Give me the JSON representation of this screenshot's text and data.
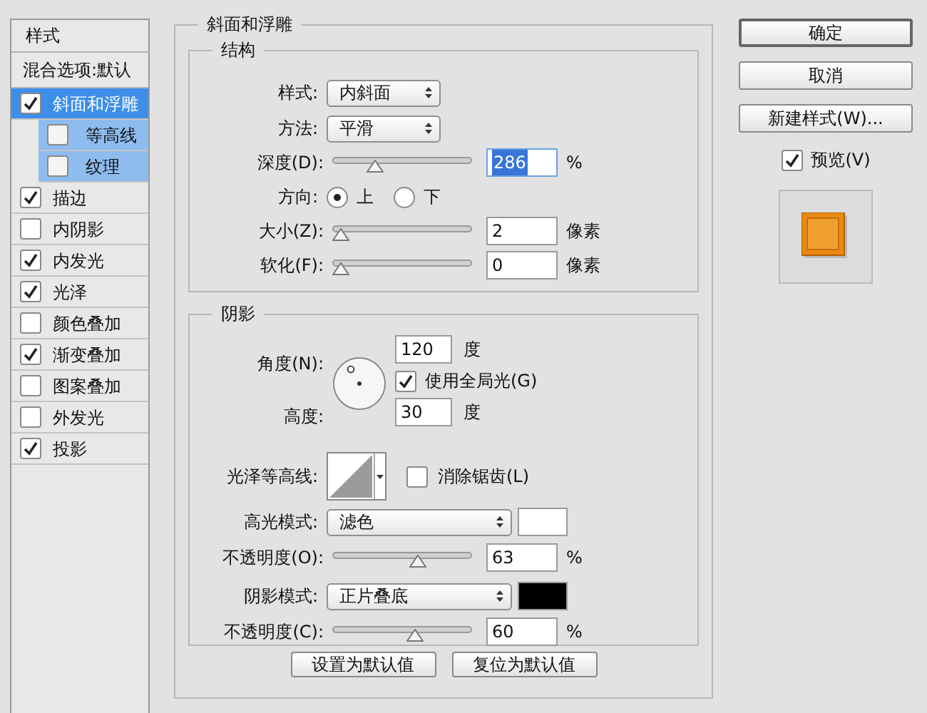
{
  "sidebar": {
    "title": "样式",
    "blending": "混合选项:默认",
    "items": [
      {
        "label": "斜面和浮雕",
        "checked": true,
        "selected": true,
        "children": [
          {
            "label": "等高线",
            "checked": false,
            "selected": false
          },
          {
            "label": "纹理",
            "checked": false,
            "selected": false
          }
        ]
      },
      {
        "label": "描边",
        "checked": true,
        "selected": false
      },
      {
        "label": "内阴影",
        "checked": false,
        "selected": false
      },
      {
        "label": "内发光",
        "checked": true,
        "selected": false
      },
      {
        "label": "光泽",
        "checked": true,
        "selected": false
      },
      {
        "label": "颜色叠加",
        "checked": false,
        "selected": false
      },
      {
        "label": "渐变叠加",
        "checked": true,
        "selected": false
      },
      {
        "label": "图案叠加",
        "checked": false,
        "selected": false
      },
      {
        "label": "外发光",
        "checked": false,
        "selected": false
      },
      {
        "label": "投影",
        "checked": true,
        "selected": false
      }
    ]
  },
  "bevel": {
    "title": "斜面和浮雕",
    "structure": {
      "title": "结构",
      "style": {
        "label": "样式:",
        "value": "内斜面"
      },
      "technique": {
        "label": "方法:",
        "value": "平滑"
      },
      "depth": {
        "label": "深度(D):",
        "level": 0.28,
        "value": "286",
        "unit": "%",
        "focused": true
      },
      "direction": {
        "label": "方向:",
        "options": [
          {
            "label": "上",
            "selected": true
          },
          {
            "label": "下",
            "selected": false
          }
        ]
      },
      "size": {
        "label": "大小(Z):",
        "level": 0,
        "value": "2",
        "unit": "像素",
        "focused": false
      },
      "soften": {
        "label": "软化(F):",
        "level": 0,
        "value": "0",
        "unit": "像素",
        "focused": false
      }
    },
    "shading": {
      "title": "阴影",
      "angle": {
        "label": "角度(N):",
        "value": "120",
        "unit": "度"
      },
      "global_light": {
        "label": "使用全局光(G)",
        "checked": true
      },
      "altitude": {
        "label": "高度:",
        "value": "30",
        "unit": "度"
      },
      "gloss_contour": {
        "label": "光泽等高线:"
      },
      "anti_alias": {
        "label": "消除锯齿(L)",
        "checked": false
      },
      "highlight_mode": {
        "label": "高光模式:",
        "value": "滤色",
        "color": "#ffffff"
      },
      "highlight_opacity": {
        "label": "不透明度(O):",
        "level": 0.63,
        "value": "63",
        "unit": "%",
        "focused": false
      },
      "shadow_mode": {
        "label": "阴影模式:",
        "value": "正片叠底",
        "color": "#000000"
      },
      "shadow_opacity": {
        "label": "不透明度(C):",
        "level": 0.6,
        "value": "60",
        "unit": "%",
        "focused": false
      }
    },
    "buttons": [
      "设置为默认值",
      "复位为默认值"
    ]
  },
  "actions": [
    {
      "label": "确定",
      "default": true
    },
    {
      "label": "取消",
      "default": false
    },
    {
      "label": "新建样式(W)...",
      "default": false
    }
  ],
  "preview": {
    "label": "预览(V)",
    "checked": true
  }
}
